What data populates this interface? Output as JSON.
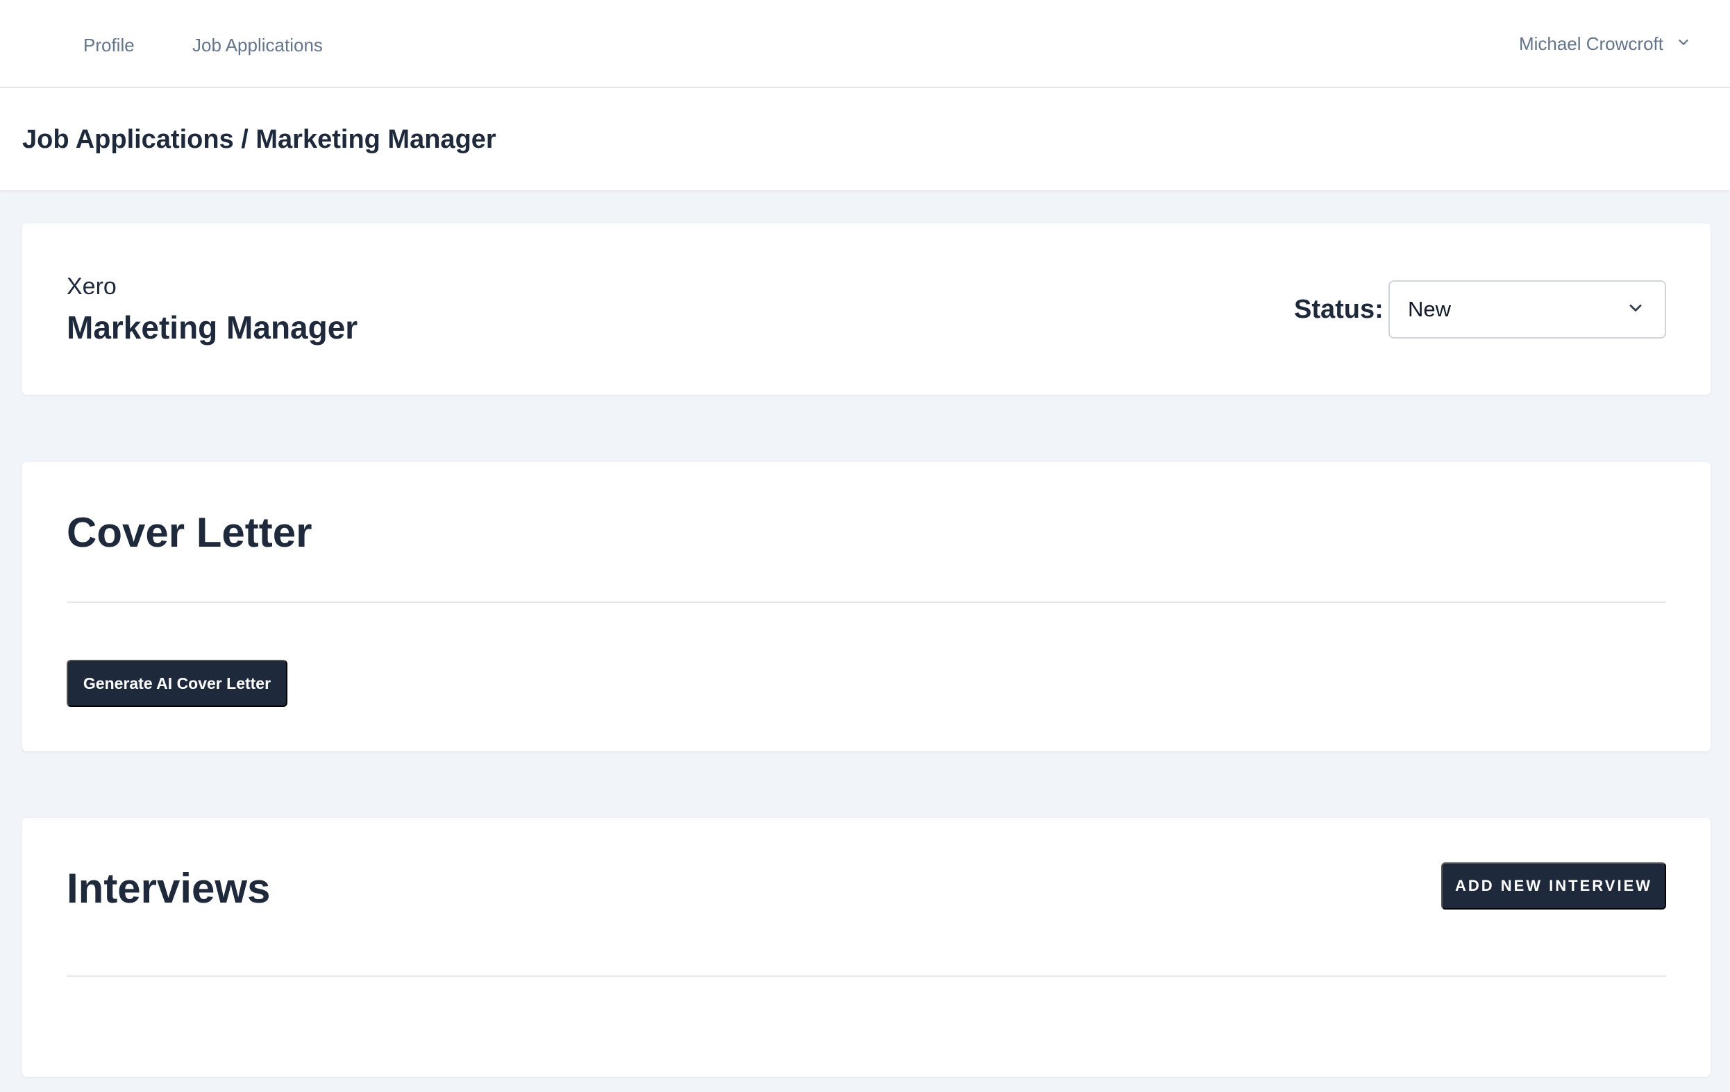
{
  "nav": {
    "links": [
      "Profile",
      "Job Applications"
    ],
    "user_name": "Michael Crowcroft",
    "user_menu_icon": "chevron-down-icon"
  },
  "header": {
    "breadcrumb": "Job Applications / Marketing Manager"
  },
  "job": {
    "company": "Xero",
    "title": "Marketing Manager",
    "status_label": "Status:",
    "status_value": "New",
    "status_icon": "chevron-down-icon"
  },
  "cover_letter": {
    "title": "Cover Letter",
    "generate_label": "Generate AI Cover Letter"
  },
  "interviews": {
    "title": "Interviews",
    "add_label": "ADD NEW INTERVIEW"
  },
  "colors": {
    "primary_dark": "#1e293b",
    "page_bg": "#f1f5f9",
    "muted_text": "#64748b"
  }
}
